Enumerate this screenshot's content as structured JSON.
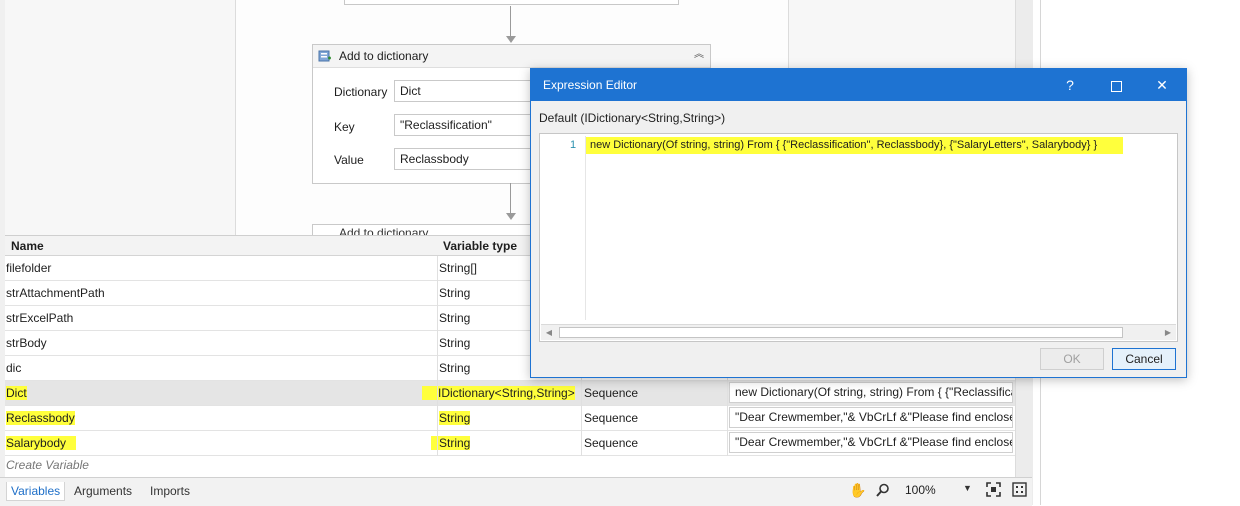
{
  "activity": {
    "title": "Add to dictionary",
    "fields": [
      {
        "label": "Dictionary",
        "value": "Dict"
      },
      {
        "label": "Key",
        "value": "\"Reclassification\""
      },
      {
        "label": "Value",
        "value": "Reclassbody"
      }
    ],
    "next_activity_partial": "Add to dictionary"
  },
  "variables": {
    "headers": {
      "name": "Name",
      "type": "Variable type"
    },
    "rows": [
      {
        "name": "filefolder",
        "type": "String[]",
        "scope": "",
        "default": "",
        "highlight": false
      },
      {
        "name": "strAttachmentPath",
        "type": "String",
        "scope": "",
        "default": "",
        "highlight": false
      },
      {
        "name": "strExcelPath",
        "type": "String",
        "scope": "",
        "default": "",
        "highlight": false
      },
      {
        "name": "strBody",
        "type": "String",
        "scope": "",
        "default": "",
        "highlight": false
      },
      {
        "name": "dic",
        "type": "String",
        "scope": "",
        "default": "",
        "highlight": false
      },
      {
        "name": "Dict",
        "type": "IDictionary<String,String>",
        "scope": "Sequence",
        "default": "new Dictionary(Of string, string) From { {\"Reclassifica",
        "highlight": true,
        "selected": true
      },
      {
        "name": "Reclassbody",
        "type": "String",
        "scope": "Sequence",
        "default": "\"Dear Crewmember,\"& VbCrLf &\"Please find enclose",
        "highlight": true
      },
      {
        "name": "Salarybody",
        "type": "String",
        "scope": "Sequence",
        "default": "\"Dear Crewmember,\"& VbCrLf &\"Please find enclose",
        "highlight": true
      }
    ],
    "create_label": "Create Variable"
  },
  "bottom_bar": {
    "tabs": [
      "Variables",
      "Arguments",
      "Imports"
    ],
    "zoom": "100%",
    "icons": [
      "hand-icon",
      "magnifier-icon",
      "zoom-dropdown-icon",
      "fit-to-screen-icon",
      "overview-icon"
    ]
  },
  "dialog": {
    "title": "Expression Editor",
    "subtitle": "Default (IDictionary<String,String>)",
    "line_number": "1",
    "code": "new Dictionary(Of string, string) From { {\"Reclassification\",  Reclassbody}, {\"SalaryLetters\", Salarybody} }",
    "ok_label": "OK",
    "cancel_label": "Cancel",
    "titlebar_icons": [
      "help-icon",
      "maximize-icon",
      "close-icon"
    ],
    "help_glyph": "?",
    "close_glyph": "✕"
  },
  "colors": {
    "highlight": "#ffff3c",
    "dialog_accent": "#1e73d2",
    "link_blue": "#1e6fc8"
  }
}
